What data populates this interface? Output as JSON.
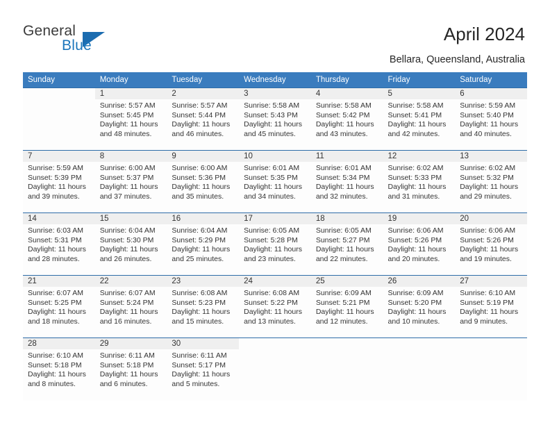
{
  "brand": {
    "name_part1": "General",
    "name_part2": "Blue",
    "accent_color": "#1b75bb",
    "logo_icon": "triangle-flag-icon"
  },
  "header": {
    "title": "April 2024",
    "subtitle": "Bellara, Queensland, Australia"
  },
  "calendar": {
    "header_bg": "#3a7cbe",
    "weekday_headers": [
      "Sunday",
      "Monday",
      "Tuesday",
      "Wednesday",
      "Thursday",
      "Friday",
      "Saturday"
    ],
    "weeks": [
      [
        {
          "date": "",
          "lines": []
        },
        {
          "date": "1",
          "lines": [
            "Sunrise: 5:57 AM",
            "Sunset: 5:45 PM",
            "Daylight: 11 hours",
            "and 48 minutes."
          ]
        },
        {
          "date": "2",
          "lines": [
            "Sunrise: 5:57 AM",
            "Sunset: 5:44 PM",
            "Daylight: 11 hours",
            "and 46 minutes."
          ]
        },
        {
          "date": "3",
          "lines": [
            "Sunrise: 5:58 AM",
            "Sunset: 5:43 PM",
            "Daylight: 11 hours",
            "and 45 minutes."
          ]
        },
        {
          "date": "4",
          "lines": [
            "Sunrise: 5:58 AM",
            "Sunset: 5:42 PM",
            "Daylight: 11 hours",
            "and 43 minutes."
          ]
        },
        {
          "date": "5",
          "lines": [
            "Sunrise: 5:58 AM",
            "Sunset: 5:41 PM",
            "Daylight: 11 hours",
            "and 42 minutes."
          ]
        },
        {
          "date": "6",
          "lines": [
            "Sunrise: 5:59 AM",
            "Sunset: 5:40 PM",
            "Daylight: 11 hours",
            "and 40 minutes."
          ]
        }
      ],
      [
        {
          "date": "7",
          "lines": [
            "Sunrise: 5:59 AM",
            "Sunset: 5:39 PM",
            "Daylight: 11 hours",
            "and 39 minutes."
          ]
        },
        {
          "date": "8",
          "lines": [
            "Sunrise: 6:00 AM",
            "Sunset: 5:37 PM",
            "Daylight: 11 hours",
            "and 37 minutes."
          ]
        },
        {
          "date": "9",
          "lines": [
            "Sunrise: 6:00 AM",
            "Sunset: 5:36 PM",
            "Daylight: 11 hours",
            "and 35 minutes."
          ]
        },
        {
          "date": "10",
          "lines": [
            "Sunrise: 6:01 AM",
            "Sunset: 5:35 PM",
            "Daylight: 11 hours",
            "and 34 minutes."
          ]
        },
        {
          "date": "11",
          "lines": [
            "Sunrise: 6:01 AM",
            "Sunset: 5:34 PM",
            "Daylight: 11 hours",
            "and 32 minutes."
          ]
        },
        {
          "date": "12",
          "lines": [
            "Sunrise: 6:02 AM",
            "Sunset: 5:33 PM",
            "Daylight: 11 hours",
            "and 31 minutes."
          ]
        },
        {
          "date": "13",
          "lines": [
            "Sunrise: 6:02 AM",
            "Sunset: 5:32 PM",
            "Daylight: 11 hours",
            "and 29 minutes."
          ]
        }
      ],
      [
        {
          "date": "14",
          "lines": [
            "Sunrise: 6:03 AM",
            "Sunset: 5:31 PM",
            "Daylight: 11 hours",
            "and 28 minutes."
          ]
        },
        {
          "date": "15",
          "lines": [
            "Sunrise: 6:04 AM",
            "Sunset: 5:30 PM",
            "Daylight: 11 hours",
            "and 26 minutes."
          ]
        },
        {
          "date": "16",
          "lines": [
            "Sunrise: 6:04 AM",
            "Sunset: 5:29 PM",
            "Daylight: 11 hours",
            "and 25 minutes."
          ]
        },
        {
          "date": "17",
          "lines": [
            "Sunrise: 6:05 AM",
            "Sunset: 5:28 PM",
            "Daylight: 11 hours",
            "and 23 minutes."
          ]
        },
        {
          "date": "18",
          "lines": [
            "Sunrise: 6:05 AM",
            "Sunset: 5:27 PM",
            "Daylight: 11 hours",
            "and 22 minutes."
          ]
        },
        {
          "date": "19",
          "lines": [
            "Sunrise: 6:06 AM",
            "Sunset: 5:26 PM",
            "Daylight: 11 hours",
            "and 20 minutes."
          ]
        },
        {
          "date": "20",
          "lines": [
            "Sunrise: 6:06 AM",
            "Sunset: 5:26 PM",
            "Daylight: 11 hours",
            "and 19 minutes."
          ]
        }
      ],
      [
        {
          "date": "21",
          "lines": [
            "Sunrise: 6:07 AM",
            "Sunset: 5:25 PM",
            "Daylight: 11 hours",
            "and 18 minutes."
          ]
        },
        {
          "date": "22",
          "lines": [
            "Sunrise: 6:07 AM",
            "Sunset: 5:24 PM",
            "Daylight: 11 hours",
            "and 16 minutes."
          ]
        },
        {
          "date": "23",
          "lines": [
            "Sunrise: 6:08 AM",
            "Sunset: 5:23 PM",
            "Daylight: 11 hours",
            "and 15 minutes."
          ]
        },
        {
          "date": "24",
          "lines": [
            "Sunrise: 6:08 AM",
            "Sunset: 5:22 PM",
            "Daylight: 11 hours",
            "and 13 minutes."
          ]
        },
        {
          "date": "25",
          "lines": [
            "Sunrise: 6:09 AM",
            "Sunset: 5:21 PM",
            "Daylight: 11 hours",
            "and 12 minutes."
          ]
        },
        {
          "date": "26",
          "lines": [
            "Sunrise: 6:09 AM",
            "Sunset: 5:20 PM",
            "Daylight: 11 hours",
            "and 10 minutes."
          ]
        },
        {
          "date": "27",
          "lines": [
            "Sunrise: 6:10 AM",
            "Sunset: 5:19 PM",
            "Daylight: 11 hours",
            "and 9 minutes."
          ]
        }
      ],
      [
        {
          "date": "28",
          "lines": [
            "Sunrise: 6:10 AM",
            "Sunset: 5:18 PM",
            "Daylight: 11 hours",
            "and 8 minutes."
          ]
        },
        {
          "date": "29",
          "lines": [
            "Sunrise: 6:11 AM",
            "Sunset: 5:18 PM",
            "Daylight: 11 hours",
            "and 6 minutes."
          ]
        },
        {
          "date": "30",
          "lines": [
            "Sunrise: 6:11 AM",
            "Sunset: 5:17 PM",
            "Daylight: 11 hours",
            "and 5 minutes."
          ]
        },
        {
          "date": "",
          "lines": []
        },
        {
          "date": "",
          "lines": []
        },
        {
          "date": "",
          "lines": []
        },
        {
          "date": "",
          "lines": []
        }
      ]
    ]
  }
}
